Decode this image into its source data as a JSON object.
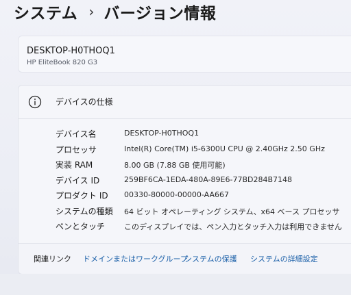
{
  "breadcrumb": {
    "parent": "システム",
    "separator": "›",
    "current": "バージョン情報"
  },
  "device": {
    "name": "DESKTOP-H0THOQ1",
    "model": "HP EliteBook 820 G3"
  },
  "specs": {
    "title": "デバイスの仕様",
    "rows": [
      {
        "label": "デバイス名",
        "value": "DESKTOP-H0THOQ1"
      },
      {
        "label": "プロセッサ",
        "value": "Intel(R) Core(TM) i5-6300U CPU @ 2.40GHz   2.50 GHz"
      },
      {
        "label": "実装 RAM",
        "value": "8.00 GB (7.88 GB 使用可能)"
      },
      {
        "label": "デバイス ID",
        "value": "259BF6CA-1EDA-480A-89E6-77BD284B7148"
      },
      {
        "label": "プロダクト ID",
        "value": "00330-80000-00000-AA667"
      },
      {
        "label": "システムの種類",
        "value": "64 ビット オペレーティング システム、x64 ベース プロセッサ"
      },
      {
        "label": "ペンとタッチ",
        "value": "このディスプレイでは、ペン入力とタッチ入力は利用できません"
      }
    ]
  },
  "related": {
    "label": "関連リンク",
    "links": [
      {
        "label": "ドメインまたはワークグループ"
      },
      {
        "label": "システムの保護"
      },
      {
        "label": "システムの詳細設定"
      }
    ]
  },
  "icons": {
    "info": "info-icon"
  }
}
